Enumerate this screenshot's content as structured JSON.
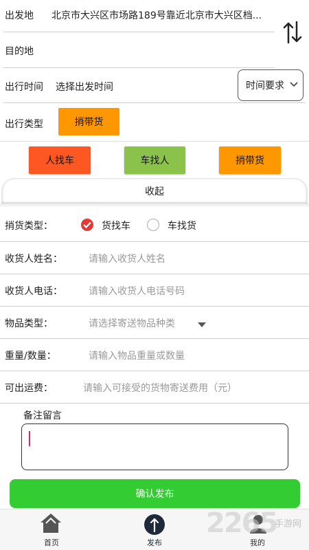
{
  "route": {
    "origin_label": "出发地",
    "origin_value": "北京市大兴区市场路189号靠近北京市大兴区档...",
    "destination_label": "目的地",
    "destination_value": ""
  },
  "time": {
    "label": "出行时间",
    "value": "选择出发时间",
    "requirement_button": "时间要求"
  },
  "trip_type": {
    "label": "出行类型",
    "selected": "捎带货"
  },
  "mode_buttons": {
    "person_find_car": "人找车",
    "car_find_person": "车找人",
    "carry_goods": "捎带货",
    "person_color": "#ff5722",
    "car_color": "#8bc34a",
    "goods_color": "#ff9800"
  },
  "collapse": {
    "label": "收起"
  },
  "form": {
    "goods_type_label": "捎货类型：",
    "option_goods_find_car": "货找车",
    "option_car_find_goods": "车找货",
    "selected_option": "货找车",
    "receiver_name_label": "收货人姓名：",
    "receiver_name_placeholder": "请输入收货人姓名",
    "receiver_phone_label": "收货人电话：",
    "receiver_phone_placeholder": "请输入收货人电话号码",
    "item_type_label": "物品类型：",
    "item_type_placeholder": "请选择寄送物品种类",
    "weight_label": "重量/数量：",
    "weight_placeholder": "请输入物品重量或数量",
    "fee_label": "可出运费：",
    "fee_placeholder": "请输入可接受的货物寄送费用（元）",
    "remark_label": "备注留言",
    "remark_value": ""
  },
  "submit": {
    "label": "确认发布",
    "color": "#33cc33"
  },
  "nav": {
    "home": "首页",
    "publish": "发布",
    "mine": "我的"
  },
  "watermark": {
    "text": "2265",
    "sub": "手游网"
  }
}
